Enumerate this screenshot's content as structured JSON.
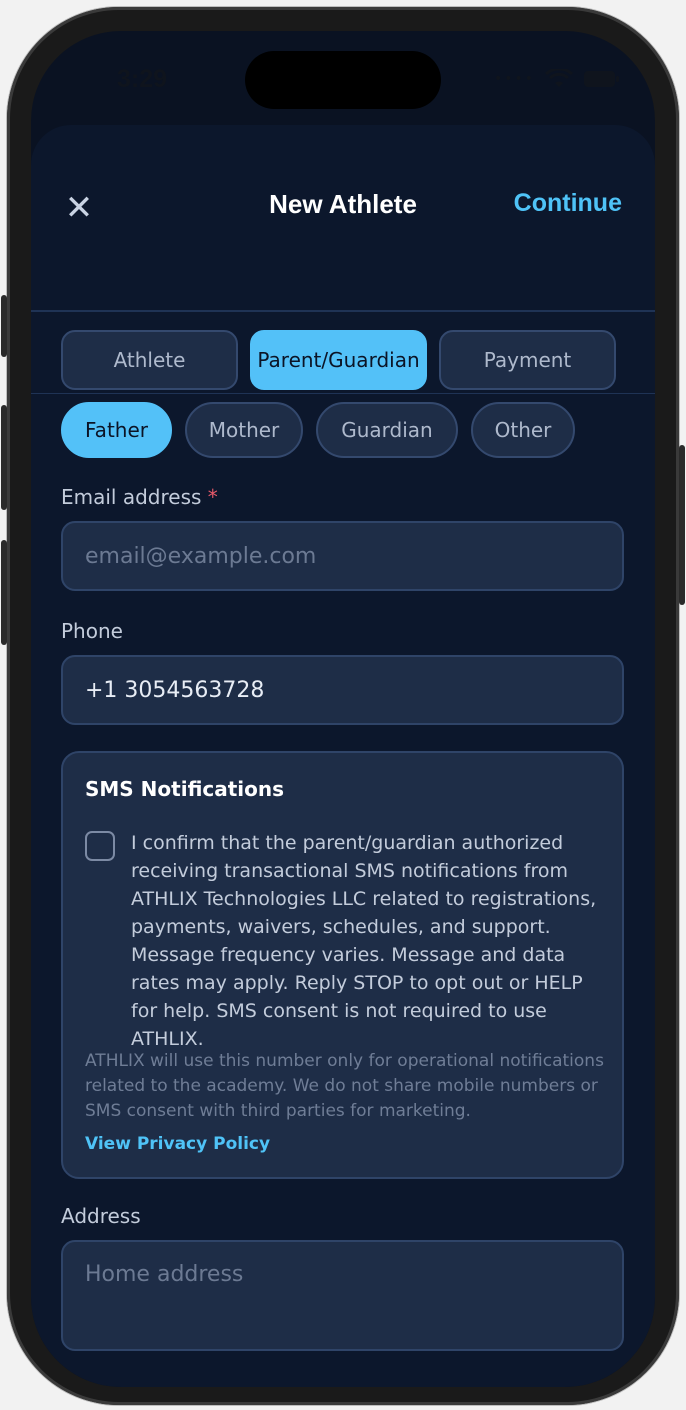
{
  "status_bar": {
    "time": "3:29"
  },
  "header": {
    "title": "New Athlete",
    "continue_label": "Continue"
  },
  "tabs": [
    {
      "label": "Athlete",
      "active": false
    },
    {
      "label": "Parent/Guardian",
      "active": true
    },
    {
      "label": "Payment",
      "active": false
    }
  ],
  "relation_chips": [
    {
      "label": "Father",
      "active": true
    },
    {
      "label": "Mother",
      "active": false
    },
    {
      "label": "Guardian",
      "active": false
    },
    {
      "label": "Other",
      "active": false
    }
  ],
  "email": {
    "label": "Email address",
    "required_mark": "*",
    "placeholder": "email@example.com",
    "value": ""
  },
  "phone": {
    "label": "Phone",
    "value": "+1 3054563728"
  },
  "sms": {
    "title": "SMS Notifications",
    "consent_text": "I confirm that the parent/guardian authorized receiving transactional SMS notifications from ATHLIX Technologies LLC related to registrations, payments, waivers, schedules, and support. Message frequency varies. Message and data rates may apply. Reply STOP to opt out or HELP for help. SMS consent is not required to use ATHLIX.",
    "checked": false,
    "note": "ATHLIX will use this number only for operational notifications related to the academy. We do not share mobile numbers or SMS consent with third parties for marketing.",
    "privacy_link": "View Privacy Policy"
  },
  "address": {
    "label": "Address",
    "placeholder": "Home address",
    "value": ""
  },
  "colors": {
    "accent": "#53c1f8",
    "background": "#0c172c",
    "field": "#1e2d47"
  }
}
